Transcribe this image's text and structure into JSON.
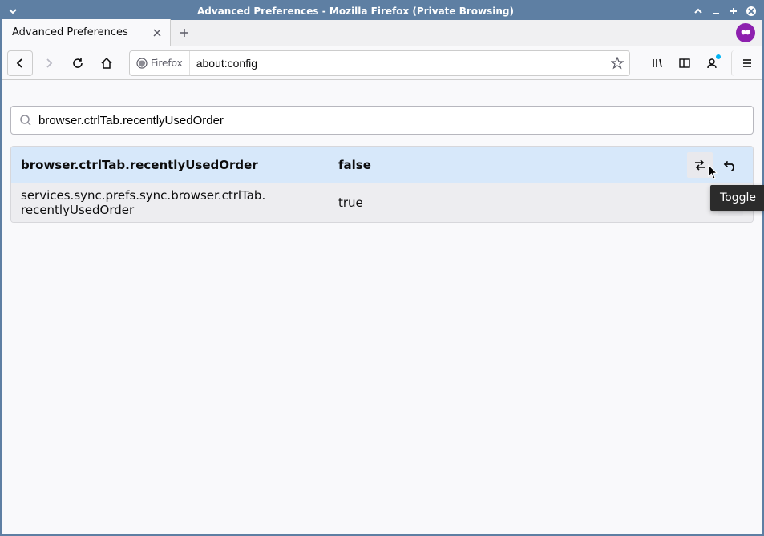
{
  "window": {
    "title": "Advanced Preferences - Mozilla Firefox (Private Browsing)"
  },
  "tab": {
    "title": "Advanced Preferences"
  },
  "urlbar": {
    "identity_label": "Firefox",
    "url": "about:config"
  },
  "search": {
    "value": "browser.ctrlTab.recentlyUsedOrder"
  },
  "prefs": [
    {
      "name": "browser.ctrlTab.recentlyUsedOrder",
      "value": "false",
      "modified": true
    },
    {
      "name": "services.sync.prefs.sync.browser.ctrlTab.recentlyUsedOrder",
      "value": "true",
      "modified": false
    }
  ],
  "tooltip": {
    "toggle": "Toggle"
  }
}
